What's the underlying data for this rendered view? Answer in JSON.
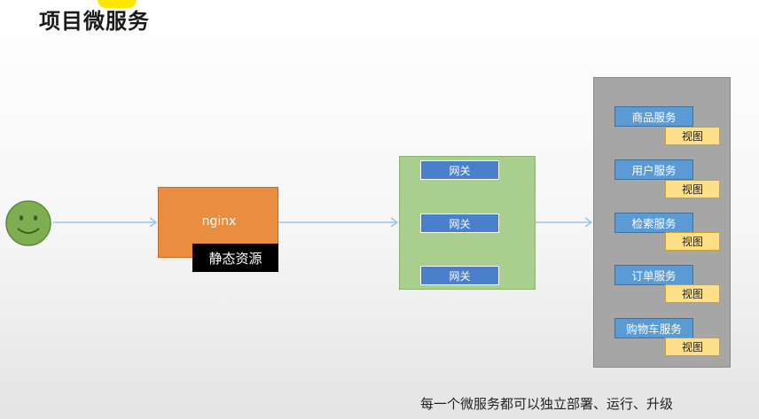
{
  "title": "项目微服务",
  "nodes": {
    "nginx": "nginx",
    "static_resources": "静态资源"
  },
  "gateways": [
    "网关",
    "网关",
    "网关"
  ],
  "services": [
    {
      "name": "商品服务",
      "view": "视图"
    },
    {
      "name": "用户服务",
      "view": "视图"
    },
    {
      "name": "检索服务",
      "view": "视图"
    },
    {
      "name": "订单服务",
      "view": "视图"
    },
    {
      "name": "购物车服务",
      "view": "视图"
    }
  ],
  "note": "每一个微服务都可以独立部署、运行、升级",
  "colors": {
    "nginx": "#e98d40",
    "gateway_box": "#a9cf8e",
    "gateway": "#4a7fcc",
    "service_box": "#a6a6a6",
    "service": "#5b9bd5",
    "view": "#ffe08a",
    "arrow": "#9dc3e6",
    "user": "#7fae52"
  },
  "icons": {
    "user": "smiley-face-icon"
  }
}
